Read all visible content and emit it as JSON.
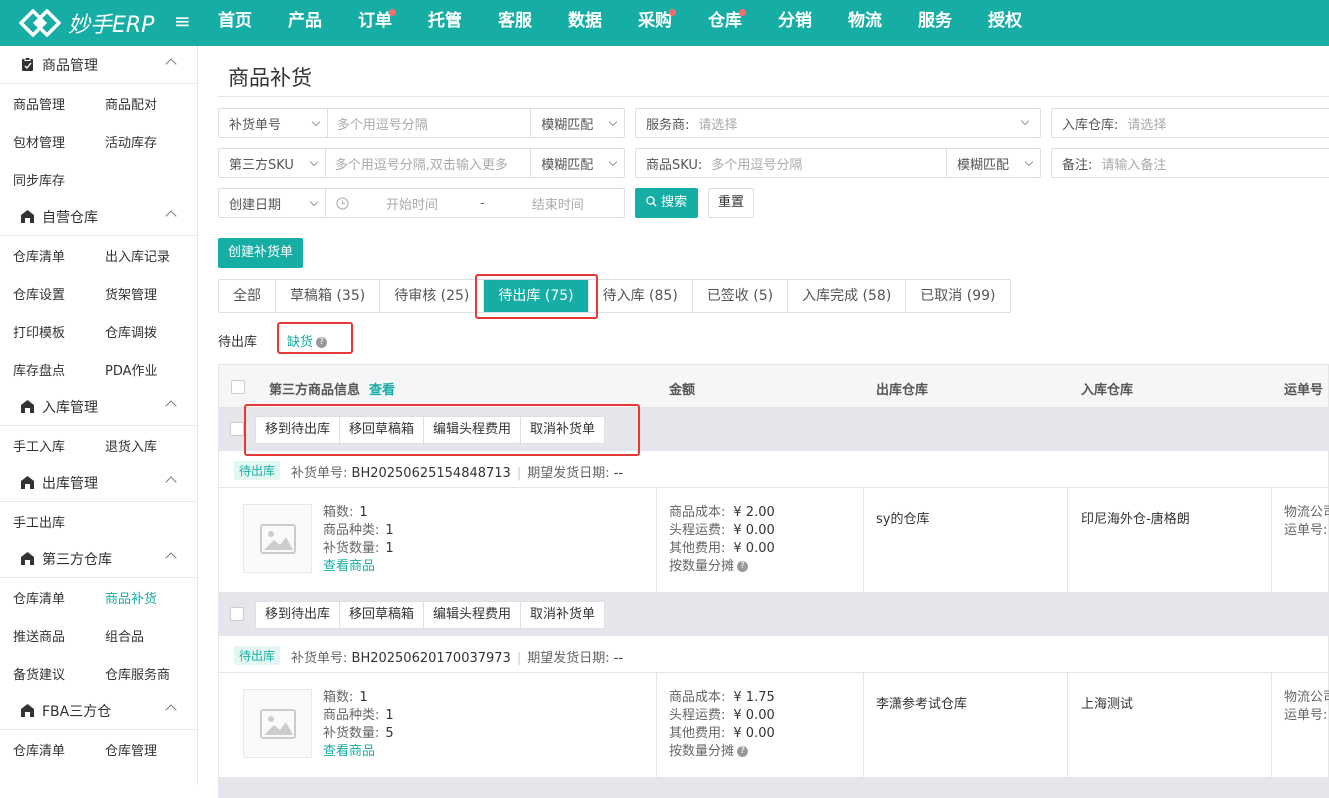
{
  "brand": {
    "name": "妙手ERP"
  },
  "topnav": [
    {
      "label": "首页",
      "dot": false
    },
    {
      "label": "产品",
      "dot": false
    },
    {
      "label": "订单",
      "dot": true
    },
    {
      "label": "托管",
      "dot": false
    },
    {
      "label": "客服",
      "dot": false
    },
    {
      "label": "数据",
      "dot": false
    },
    {
      "label": "采购",
      "dot": true
    },
    {
      "label": "仓库",
      "dot": true
    },
    {
      "label": "分销",
      "dot": false
    },
    {
      "label": "物流",
      "dot": false
    },
    {
      "label": "服务",
      "dot": false
    },
    {
      "label": "授权",
      "dot": false
    }
  ],
  "sidebar": {
    "groups": [
      {
        "title": "商品管理",
        "icon": "clipboard-icon",
        "rows": [
          [
            "商品管理",
            "商品配对"
          ],
          [
            "包材管理",
            "活动库存"
          ],
          [
            "同步库存",
            ""
          ]
        ]
      },
      {
        "title": "自营仓库",
        "icon": "warehouse-icon",
        "rows": [
          [
            "仓库清单",
            "出入库记录"
          ],
          [
            "仓库设置",
            "货架管理"
          ],
          [
            "打印模板",
            "仓库调拨"
          ],
          [
            "库存盘点",
            "PDA作业"
          ]
        ]
      },
      {
        "title": "入库管理",
        "icon": "warehouse-icon",
        "rows": [
          [
            "手工入库",
            "退货入库"
          ]
        ]
      },
      {
        "title": "出库管理",
        "icon": "warehouse-icon",
        "rows": [
          [
            "手工出库",
            ""
          ]
        ]
      },
      {
        "title": "第三方仓库",
        "icon": "warehouse-icon",
        "rows": [
          [
            "仓库清单",
            "商品补货"
          ],
          [
            "推送商品",
            "组合品"
          ],
          [
            "备货建议",
            "仓库服务商"
          ]
        ]
      },
      {
        "title": "FBA三方仓",
        "icon": "warehouse-icon",
        "rows": [
          [
            "仓库清单",
            "仓库管理"
          ]
        ]
      }
    ],
    "active": "商品补货"
  },
  "page": {
    "title": "商品补货"
  },
  "filters": {
    "replenish_no": {
      "label": "补货单号",
      "placeholder": "多个用逗号分隔",
      "match": "模糊匹配"
    },
    "provider": {
      "label": "服务商:",
      "placeholder": "请选择"
    },
    "inbound_wh": {
      "label": "入库仓库:",
      "placeholder": "请选择"
    },
    "third_sku": {
      "label": "第三方SKU",
      "placeholder": "多个用逗号分隔,双击输入更多",
      "match": "模糊匹配"
    },
    "product_sku": {
      "label": "商品SKU:",
      "placeholder": "多个用逗号分隔",
      "match": "模糊匹配"
    },
    "remark": {
      "label": "备注:",
      "placeholder": "请输入备注"
    },
    "date": {
      "label": "创建日期",
      "start": "开始时间",
      "sep": "-",
      "end": "结束时间"
    },
    "search_label": "搜索",
    "reset_label": "重置"
  },
  "create_label": "创建补货单",
  "tabs": [
    "全部",
    "草稿箱 (35)",
    "待审核 (25)",
    "待出库 (75)",
    "待入库 (85)",
    "已签收 (5)",
    "入库完成 (58)",
    "已取消 (99)"
  ],
  "active_tab": "待出库 (75)",
  "subtabs": {
    "current": "待出库",
    "shortage": "缺货"
  },
  "table": {
    "headers": {
      "product": "第三方商品信息",
      "view": "查看",
      "amount": "金额",
      "outbound": "出库仓库",
      "inbound": "入库仓库",
      "tracking": "运单号"
    },
    "actions": [
      "移到待出库",
      "移回草稿箱",
      "编辑头程费用",
      "取消补货单"
    ],
    "orders": [
      {
        "status": "待出库",
        "no_label": "补货单号:",
        "no": "BH20250625154848713",
        "date_label": "期望发货日期:",
        "date": "--",
        "boxes_label": "箱数:",
        "boxes": "1",
        "types_label": "商品种类:",
        "types": "1",
        "qty_label": "补货数量:",
        "qty": "1",
        "view_goods": "查看商品",
        "cost_label": "商品成本:",
        "cost": "¥ 2.00",
        "freight_label": "头程运费:",
        "freight": "¥ 0.00",
        "other_label": "其他费用:",
        "other": "¥ 0.00",
        "split": "按数量分摊",
        "outbound": "sy的仓库",
        "inbound": "印尼海外仓-唐格朗",
        "logistics": "物流公司",
        "tracking_label": "运单号:"
      },
      {
        "status": "待出库",
        "no_label": "补货单号:",
        "no": "BH20250620170037973",
        "date_label": "期望发货日期:",
        "date": "--",
        "boxes_label": "箱数:",
        "boxes": "1",
        "types_label": "商品种类:",
        "types": "1",
        "qty_label": "补货数量:",
        "qty": "5",
        "view_goods": "查看商品",
        "cost_label": "商品成本:",
        "cost": "¥ 1.75",
        "freight_label": "头程运费:",
        "freight": "¥ 0.00",
        "other_label": "其他费用:",
        "other": "¥ 0.00",
        "split": "按数量分摊",
        "outbound": "李潇参考试仓库",
        "inbound": "上海测试",
        "logistics": "物流公司",
        "tracking_label": "运单号:"
      }
    ]
  },
  "colors": {
    "brand": "#16aea4",
    "highlight": "#e53935",
    "dot": "#ff6b6b"
  }
}
